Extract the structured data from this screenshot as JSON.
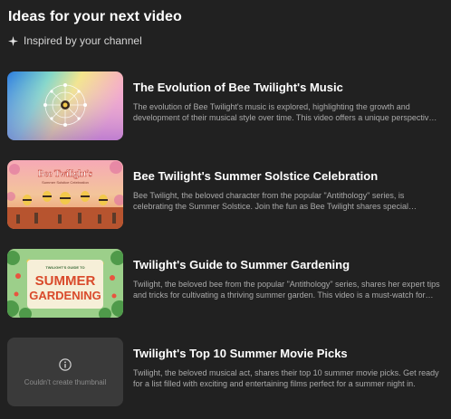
{
  "header": {
    "title": "Ideas for your next video",
    "subtitle": "Inspired by your channel"
  },
  "ideas": [
    {
      "title": "The Evolution of Bee Twilight's Music",
      "description": "The evolution of Bee Twilight's music is explored, highlighting the growth and development of their musical style over time. This video offers a unique perspective into the artist's journey."
    },
    {
      "title": "Bee Twilight's Summer Solstice Celebration",
      "description": "Bee Twilight, the beloved character from the popular \"Antithology\" series, is celebrating the Summer Solstice. Join the fun as Bee Twilight shares special traditions, recipes, and more.",
      "thumb_title": "Bee Twilight's",
      "thumb_subtitle": "Summer Solstice Celebration"
    },
    {
      "title": "Twilight's Guide to Summer Gardening",
      "description": "Twilight, the beloved bee from the popular \"Antithology\" series, shares her expert tips and tricks for cultivating a thriving summer garden. This video is a must-watch for anyone who loves plants.",
      "thumb_kicker": "TWILIGHT'S GUIDE TO",
      "thumb_line1": "SUMMER",
      "thumb_line2": "GARDENING"
    },
    {
      "title": "Twilight's Top 10 Summer Movie Picks",
      "description": "Twilight, the beloved musical act, shares their top 10 summer movie picks. Get ready for a list filled with exciting and entertaining films perfect for a summer night in.",
      "placeholder_text": "Couldn't create thumbnail"
    }
  ]
}
